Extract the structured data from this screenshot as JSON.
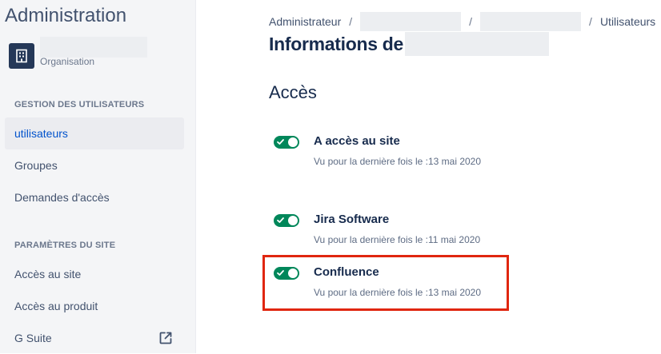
{
  "sidebar": {
    "app_title": "Administration",
    "org_caption": "Organisation",
    "sections": [
      {
        "header": "GESTION DES UTILISATEURS",
        "items": [
          {
            "label": "utilisateurs"
          },
          {
            "label": "Groupes"
          },
          {
            "label": "Demandes d'accès"
          }
        ]
      },
      {
        "header": "PARAMÈTRES DU SITE",
        "items": [
          {
            "label": "Accès au site"
          },
          {
            "label": "Accès au produit"
          },
          {
            "label": "G Suite",
            "icon": "external-link-icon"
          }
        ]
      }
    ]
  },
  "breadcrumb": {
    "items": [
      "Administrateur",
      "",
      "",
      "Utilisateurs"
    ],
    "separator": "/"
  },
  "page": {
    "title_prefix": "Informations de",
    "section_title": "Accès"
  },
  "access": [
    {
      "product": "A accès au site",
      "last_seen": "Vu pour la dernière fois le :13 mai 2020",
      "enabled": true
    },
    {
      "product": "Jira Software",
      "last_seen": "Vu pour la dernière fois le :11 mai 2020",
      "enabled": true
    },
    {
      "product": "Confluence",
      "last_seen": "Vu pour la dernière fois le :13 mai 2020",
      "enabled": true,
      "highlighted": true
    }
  ],
  "colors": {
    "toggle_on": "#00875a",
    "highlight": "#e0260f",
    "active_nav_text": "#0052cc"
  }
}
